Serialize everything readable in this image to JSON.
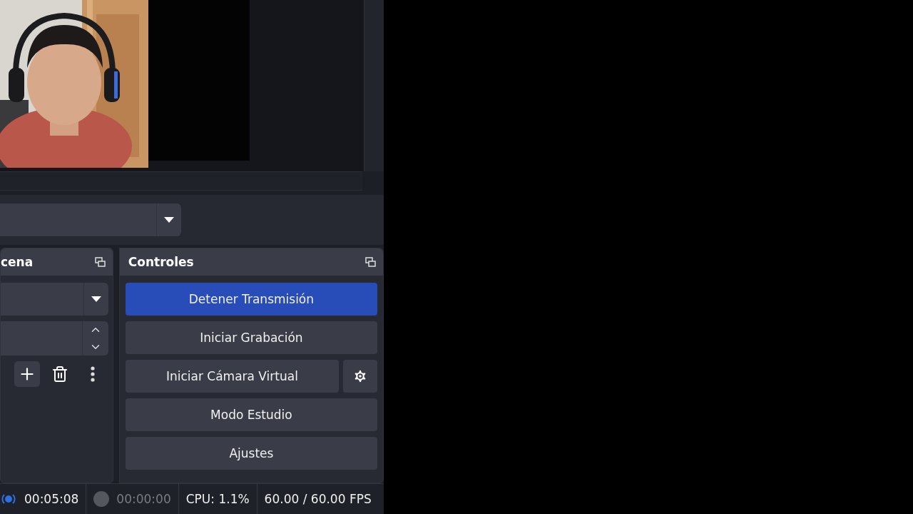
{
  "scene_dock": {
    "title": "cena"
  },
  "controls_dock": {
    "title": "Controles",
    "buttons": [
      {
        "label": "Detener Transmisión",
        "active": true,
        "has_settings": false
      },
      {
        "label": "Iniciar Grabación",
        "active": false,
        "has_settings": false
      },
      {
        "label": "Iniciar Cámara Virtual",
        "active": false,
        "has_settings": true
      },
      {
        "label": "Modo Estudio",
        "active": false,
        "has_settings": false
      },
      {
        "label": "Ajustes",
        "active": false,
        "has_settings": false
      }
    ]
  },
  "status_bar": {
    "stream": {
      "active": true,
      "time": "00:05:08"
    },
    "record": {
      "active": false,
      "time": "00:00:00"
    },
    "cpu": "CPU: 1.1%",
    "fps": "60.00 / 60.00 FPS"
  }
}
